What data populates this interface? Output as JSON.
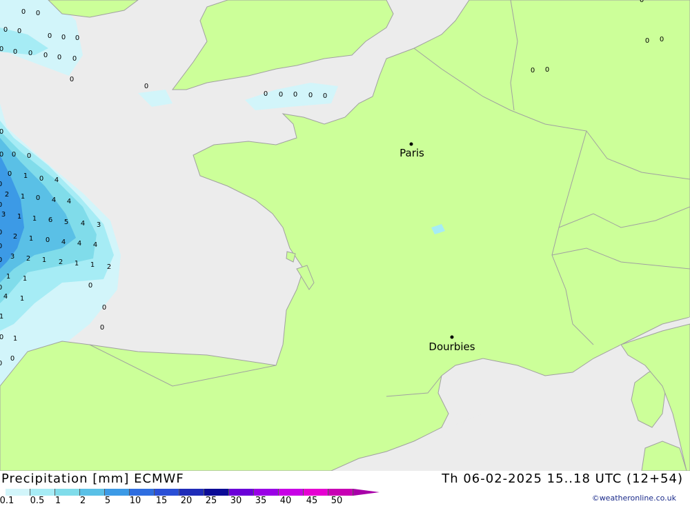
{
  "map": {
    "cities": [
      {
        "name": "Paris"
      },
      {
        "name": "Dourbies"
      }
    ],
    "colors": {
      "land": "#ccff99",
      "sea": "#ececec",
      "border": "#a0a0a0",
      "precip_0_1": "#d2f5fa",
      "precip_0_5": "#a6ecf5",
      "precip_1": "#80dcea",
      "precip_2": "#5ac0e6",
      "precip_5": "#3c9ae6"
    },
    "precip_labels": [
      "0",
      "0",
      "0",
      "0",
      "0",
      "0",
      "0",
      "0",
      "0",
      "0",
      "0",
      "0",
      "0",
      "0",
      "0",
      "0",
      "0",
      "0",
      "0",
      "0",
      "0",
      "0",
      "0",
      "0",
      "0",
      "0",
      "0",
      "0",
      "0",
      "0",
      "1",
      "0",
      "4",
      "2",
      "1",
      "0",
      "4",
      "4",
      "3",
      "1",
      "1",
      "6",
      "5",
      "4",
      "3",
      "2",
      "1",
      "0",
      "4",
      "4",
      "4",
      "3",
      "2",
      "1",
      "2",
      "1",
      "1",
      "2",
      "1",
      "1",
      "0",
      "4",
      "1",
      "0",
      "1",
      "0",
      "0",
      "1",
      "0",
      "0",
      "0",
      "0",
      "0",
      "0",
      "0",
      "0"
    ]
  },
  "footer": {
    "title_left": "Precipitation [mm] ECMWF",
    "title_right": "Th 06-02-2025 15..18 UTC (12+54)",
    "credit": "©weatheronline.co.uk",
    "legend": {
      "labels": [
        "0.1",
        "0.5",
        "1",
        "2",
        "5",
        "10",
        "15",
        "20",
        "25",
        "30",
        "35",
        "40",
        "45",
        "50"
      ],
      "colors": [
        "#d2f5fa",
        "#a6ecf5",
        "#80dcea",
        "#5ac0e6",
        "#3c9ae6",
        "#2f6ee0",
        "#2a4fd6",
        "#1f2cb8",
        "#0b0b96",
        "#6a00d8",
        "#9a00e6",
        "#c800e6",
        "#e600d2",
        "#c800b4"
      ],
      "arrow_color": "#a800a8"
    }
  }
}
